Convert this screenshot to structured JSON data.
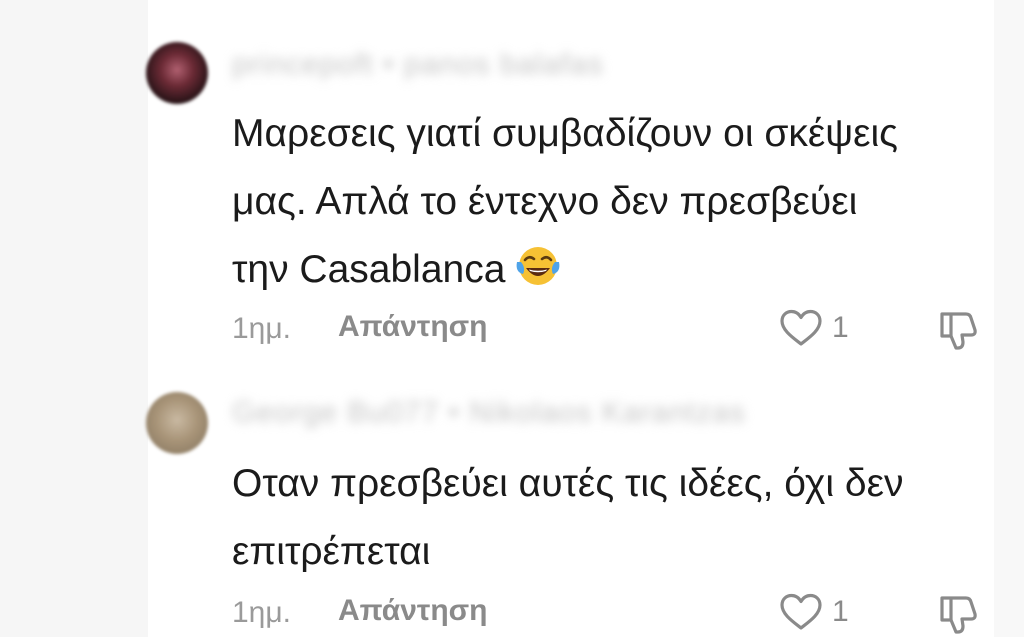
{
  "comments": [
    {
      "names": "princepoft • panos balafas",
      "lines": [
        "Μαρεσεις γιατί συμβαδίζουν οι σκέψεις",
        "μας. Απλά το έντεχνο δεν πρεσβεύει",
        "την Casablanca"
      ],
      "emoji": "tears-of-joy-emoji",
      "time": "1ημ.",
      "reply_label": "Απάντηση",
      "like_count": "1"
    },
    {
      "names": "George Bu077 • Nikolaos Karantzas",
      "lines": [
        "Οταν πρεσβεύει αυτές τις ιδέες, όχι δεν",
        "επιτρέπεται"
      ],
      "time": "1ημ.",
      "reply_label": "Απάντηση",
      "like_count": "1"
    }
  ],
  "colors": {
    "text": "#1b1b1b",
    "muted": "#8a8a8a",
    "emoji_face": "#f6c134"
  }
}
